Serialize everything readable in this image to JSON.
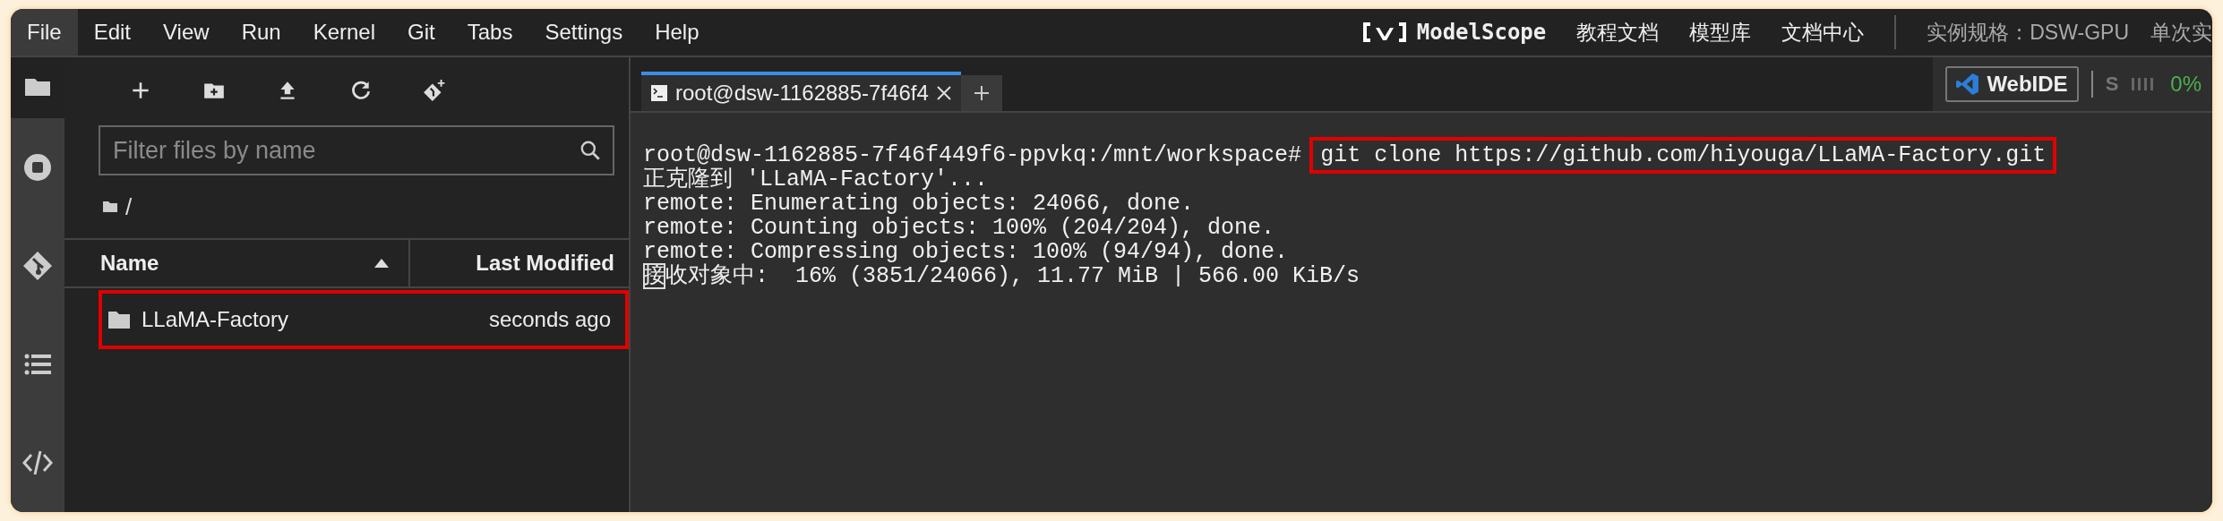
{
  "menu": [
    {
      "label": "File",
      "selected": true
    },
    {
      "label": "Edit",
      "selected": false
    },
    {
      "label": "View",
      "selected": false
    },
    {
      "label": "Run",
      "selected": false
    },
    {
      "label": "Kernel",
      "selected": false
    },
    {
      "label": "Git",
      "selected": false
    },
    {
      "label": "Tabs",
      "selected": false
    },
    {
      "label": "Settings",
      "selected": false
    },
    {
      "label": "Help",
      "selected": false
    }
  ],
  "header": {
    "brand": "ModelScope",
    "links": [
      "教程文档",
      "模型库",
      "文档中心"
    ],
    "instance_spec": "实例规格：DSW-GPU",
    "cut_label": "单次实"
  },
  "activity_bar": [
    {
      "selected": true
    },
    {
      "selected": false
    },
    {
      "selected": false
    },
    {
      "selected": false
    },
    {
      "selected": false
    }
  ],
  "file_browser": {
    "filter": {
      "placeholder": "Filter files by name"
    },
    "breadcrumb": "/",
    "columns": [
      {
        "label": "Name",
        "sorted": true
      },
      {
        "label": "Last Modified",
        "sorted": false
      }
    ],
    "rows": [
      {
        "name": "LLaMA-Factory",
        "modified": "seconds ago",
        "highlighted": true
      }
    ]
  },
  "terminal_tabs": [
    {
      "title": "root@dsw-1162885-7f46f4",
      "selected": true
    }
  ],
  "toolbar": {
    "webide": "WebIDE",
    "status_letter": "S",
    "usage": "0%"
  },
  "terminal": {
    "prompt": "root@dsw-1162885-7f46f449f6-ppvkq:/mnt/workspace# ",
    "command": "git clone https://github.com/hiyouga/LLaMA-Factory.git",
    "command_highlighted": true,
    "lines": [
      "正克隆到 'LLaMA-Factory'...",
      "remote: Enumerating objects: 24066, done.",
      "remote: Counting objects: 100% (204/204), done.",
      "remote: Compressing objects: 100% (94/94), done."
    ],
    "cursor_char": "接",
    "cursor_line": "收对象中:  16% (3851/24066), 11.77 MiB | 566.00 KiB/s"
  }
}
